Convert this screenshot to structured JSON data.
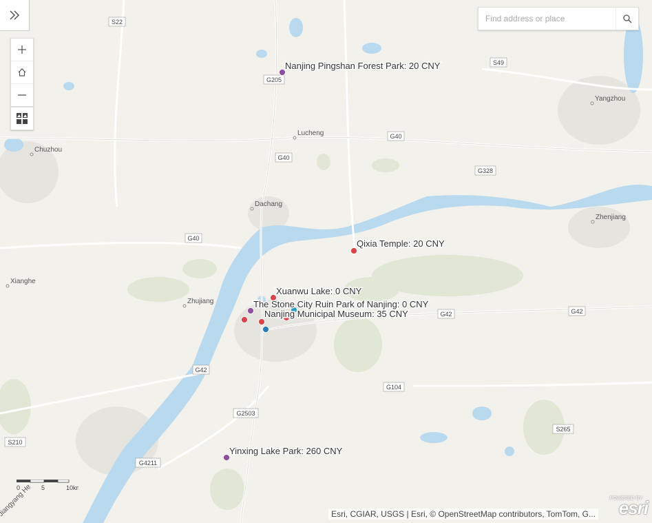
{
  "search": {
    "placeholder": "Find address or place"
  },
  "icons": {
    "expand": "double-chevron-right-icon",
    "zoom_in": "plus-icon",
    "home": "home-icon",
    "zoom_out": "minus-icon",
    "basemap": "basemap-gallery-icon",
    "search": "search-icon"
  },
  "map": {
    "places": [
      {
        "name": "Lucheng"
      },
      {
        "name": "Yangzhou"
      },
      {
        "name": "Chuzhou"
      },
      {
        "name": "Dachang"
      },
      {
        "name": "Zhenjiang"
      },
      {
        "name": "Xianghe"
      },
      {
        "name": "Zhujiang"
      }
    ],
    "roads": [
      {
        "ref": "S22"
      },
      {
        "ref": "G205"
      },
      {
        "ref": "S49"
      },
      {
        "ref": "G40"
      },
      {
        "ref": "G40"
      },
      {
        "ref": "G328"
      },
      {
        "ref": "G40"
      },
      {
        "ref": "G42"
      },
      {
        "ref": "G42"
      },
      {
        "ref": "G42"
      },
      {
        "ref": "G104"
      },
      {
        "ref": "G2503"
      },
      {
        "ref": "S265"
      },
      {
        "ref": "S210"
      },
      {
        "ref": "G4211"
      }
    ],
    "river_label": "Jiangyang He",
    "pois": [
      {
        "label": "Nanjing Pingshan Forest Park: 20 CNY",
        "color": "#8e4f9e"
      },
      {
        "label": "Qixia Temple: 20 CNY",
        "color": "#d9454b"
      },
      {
        "label": "Xuanwu Lake: 0 CNY",
        "color": "#d9454b"
      },
      {
        "label": "The Stone City Ruin Park of Nanjing: 0 CNY",
        "color": "#8e4f9e"
      },
      {
        "label": "Nanjing Municipal Museum: 35 CNY",
        "color": "#d9454b"
      },
      {
        "label": "Yinxing Lake Park: 260 CNY",
        "color": "#8e4f9e"
      }
    ],
    "extra_markers": [
      {
        "color": "#d9454b"
      },
      {
        "color": "#d9454b"
      },
      {
        "color": "#2b7bb9"
      },
      {
        "color": "#2b9bc9"
      }
    ]
  },
  "scale": {
    "ticks": [
      "0",
      "5",
      "10km"
    ]
  },
  "attribution": "Esri, CGIAR, USGS | Esri, © OpenStreetMap contributors, TomTom, G...",
  "logo": {
    "powered": "POWERED BY",
    "brand": "esri"
  }
}
